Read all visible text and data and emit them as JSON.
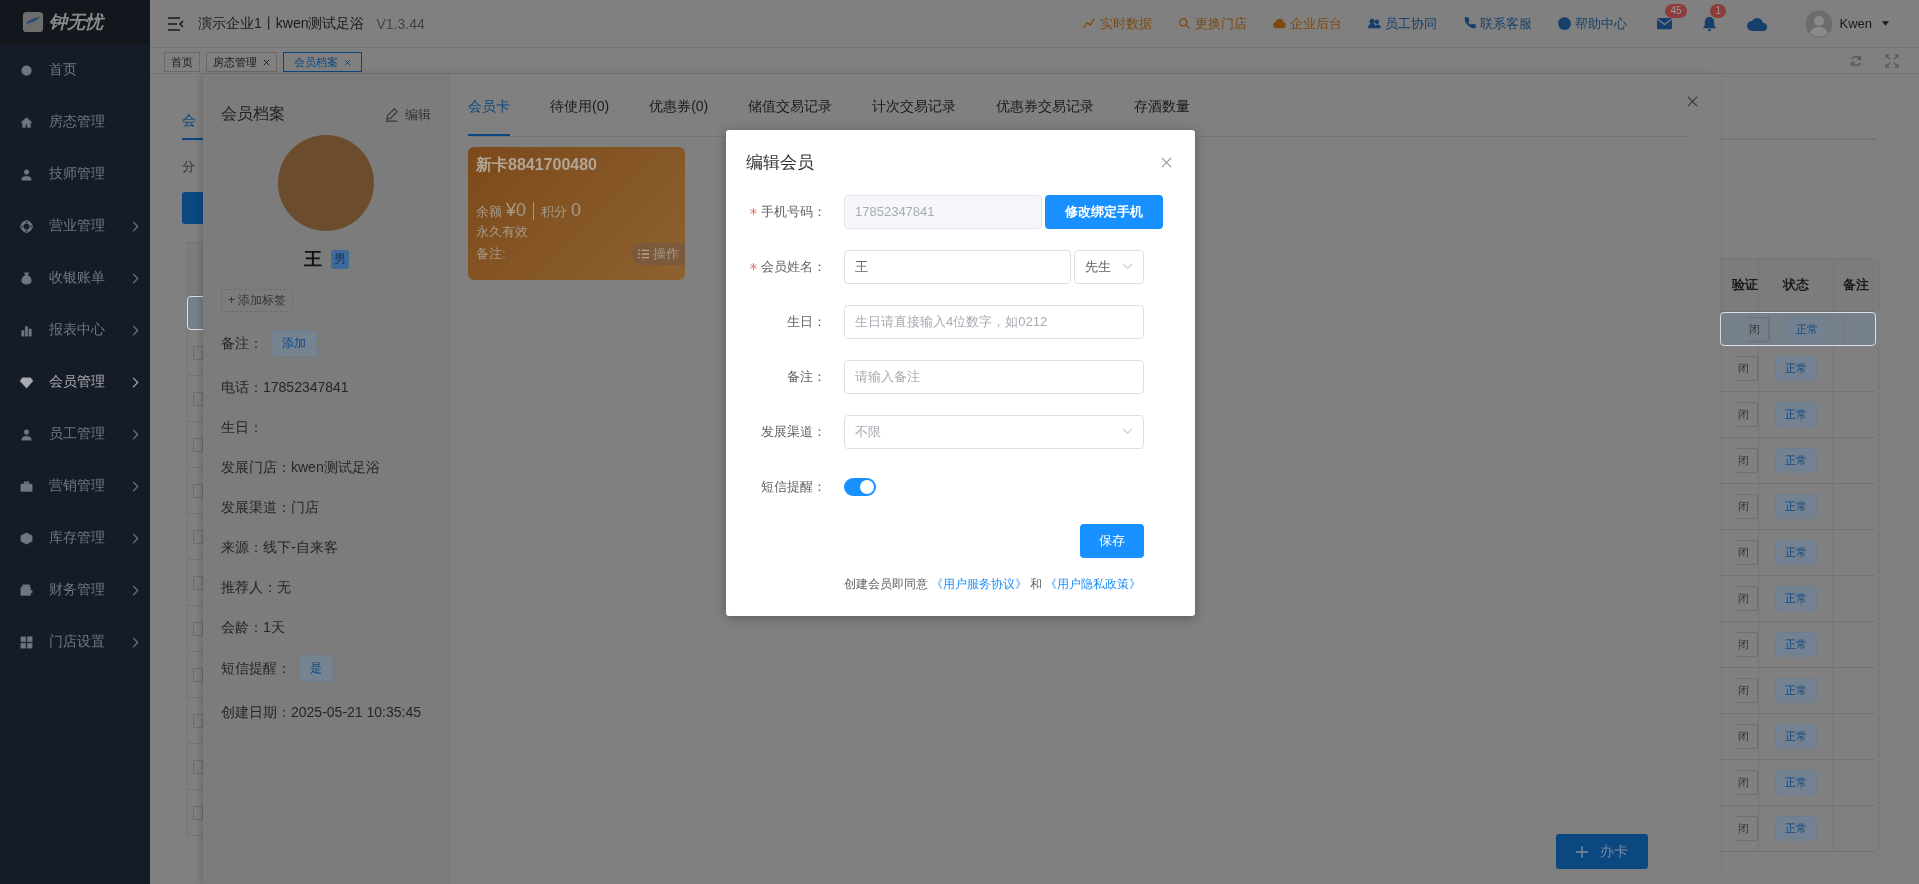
{
  "sidebar": {
    "logo_text": "钟无忧",
    "items": [
      {
        "label": "首页",
        "has_submenu": false,
        "selected": false
      },
      {
        "label": "房态管理",
        "has_submenu": false,
        "selected": false
      },
      {
        "label": "技师管理",
        "has_submenu": false,
        "selected": false
      },
      {
        "label": "营业管理",
        "has_submenu": true,
        "selected": false
      },
      {
        "label": "收银账单",
        "has_submenu": true,
        "selected": false
      },
      {
        "label": "报表中心",
        "has_submenu": true,
        "selected": false
      },
      {
        "label": "会员管理",
        "has_submenu": true,
        "selected": true
      },
      {
        "label": "员工管理",
        "has_submenu": true,
        "selected": false
      },
      {
        "label": "营销管理",
        "has_submenu": true,
        "selected": false
      },
      {
        "label": "库存管理",
        "has_submenu": true,
        "selected": false
      },
      {
        "label": "财务管理",
        "has_submenu": true,
        "selected": false
      },
      {
        "label": "门店设置",
        "has_submenu": true,
        "selected": false
      }
    ]
  },
  "header": {
    "title": "演示企业1丨kwen测试足浴",
    "version": "V1.3.44",
    "links": [
      {
        "label": "实时数据",
        "color": "#7d4a0e"
      },
      {
        "label": "更换门店",
        "color": "#7d4a0e"
      },
      {
        "label": "企业后台",
        "color": "#7d4a0e"
      },
      {
        "label": "员工协同",
        "color": "#173f6b"
      },
      {
        "label": "联系客服",
        "color": "#173f6b"
      },
      {
        "label": "帮助中心",
        "color": "#173f6b"
      }
    ],
    "badges": [
      "45",
      "1"
    ],
    "user": "Kwen"
  },
  "tabs": [
    {
      "label": "首页",
      "closable": false,
      "selected": false
    },
    {
      "label": "房态管理",
      "closable": true,
      "selected": false
    },
    {
      "label": "会员档案",
      "closable": true,
      "selected": true
    }
  ],
  "page": {
    "left_tab": "会",
    "left_text": "分",
    "table": {
      "columns": [
        "验证",
        "状态",
        "备注"
      ],
      "rows": [
        {
          "switch": "闭",
          "status": "正常",
          "selected": true
        },
        {
          "switch": "闭",
          "status": "正常",
          "selected": false
        },
        {
          "switch": "闭",
          "status": "正常",
          "selected": false
        },
        {
          "switch": "闭",
          "status": "正常",
          "selected": false
        },
        {
          "switch": "闭",
          "status": "正常",
          "selected": false
        },
        {
          "switch": "闭",
          "status": "正常",
          "selected": false
        },
        {
          "switch": "闭",
          "status": "正常",
          "selected": false
        },
        {
          "switch": "闭",
          "status": "正常",
          "selected": false
        },
        {
          "switch": "闭",
          "status": "正常",
          "selected": false
        },
        {
          "switch": "闭",
          "status": "正常",
          "selected": false
        },
        {
          "switch": "闭",
          "status": "正常",
          "selected": false
        },
        {
          "switch": "闭",
          "status": "正常",
          "selected": false
        }
      ]
    }
  },
  "drawer": {
    "profile": {
      "title": "会员档案",
      "edit": "编辑",
      "name": "王",
      "gender": "男",
      "add_tag": "+ 添加标签",
      "remark_label": "备注：",
      "remark_button": "添加",
      "fields": [
        {
          "label": "电话：",
          "value": "17852347841"
        },
        {
          "label": "生日："
        },
        {
          "label": "发展门店：",
          "value": "kwen测试足浴"
        },
        {
          "label": "发展渠道：",
          "value": "门店"
        },
        {
          "label": "来源：",
          "value": "线下-自来客"
        },
        {
          "label": "推荐人：",
          "value": "无"
        },
        {
          "label": "会龄：",
          "value": "1天"
        }
      ],
      "sms_label": "短信提醒：",
      "sms_value": "是",
      "created": "创建日期：2025-05-21 10:35:45"
    },
    "tabs": [
      {
        "label": "会员卡",
        "selected": true
      },
      {
        "label": "待使用(0)",
        "selected": false
      },
      {
        "label": "优惠券(0)",
        "selected": false
      },
      {
        "label": "储值交易记录",
        "selected": false
      },
      {
        "label": "计次交易记录",
        "selected": false
      },
      {
        "label": "优惠券交易记录",
        "selected": false
      },
      {
        "label": "存酒数量",
        "selected": false
      }
    ],
    "cards": [
      {
        "title": "新卡8841700480",
        "balance_label": "余额",
        "balance": "¥0",
        "points_label": "积分",
        "points": "0",
        "validity": "永久有效",
        "remark": "备注:",
        "action": "操作"
      }
    ],
    "new_card_button": "办卡"
  },
  "modal": {
    "title": "编辑会员",
    "fields": [
      {
        "kind": "phone",
        "label": "手机号码：",
        "required": true,
        "value": "17852347841",
        "disabled": true,
        "button": "修改绑定手机"
      },
      {
        "kind": "name",
        "label": "会员姓名：",
        "required": true,
        "value": "王",
        "select": "先生"
      },
      {
        "kind": "input",
        "label": "生日：",
        "required": false,
        "placeholder": "生日请直接输入4位数字，如0212"
      },
      {
        "kind": "input",
        "label": "备注：",
        "required": false,
        "placeholder": "请输入备注"
      },
      {
        "kind": "select",
        "label": "发展渠道：",
        "required": false,
        "placeholder": "不限"
      },
      {
        "kind": "switch",
        "label": "短信提醒：",
        "required": false,
        "on": true
      }
    ],
    "save": "保存",
    "agreement": {
      "text": "创建会员即同意",
      "link_1": "《用户服务协议》",
      "and": "和",
      "link_2": "《用户隐私政策》"
    }
  }
}
